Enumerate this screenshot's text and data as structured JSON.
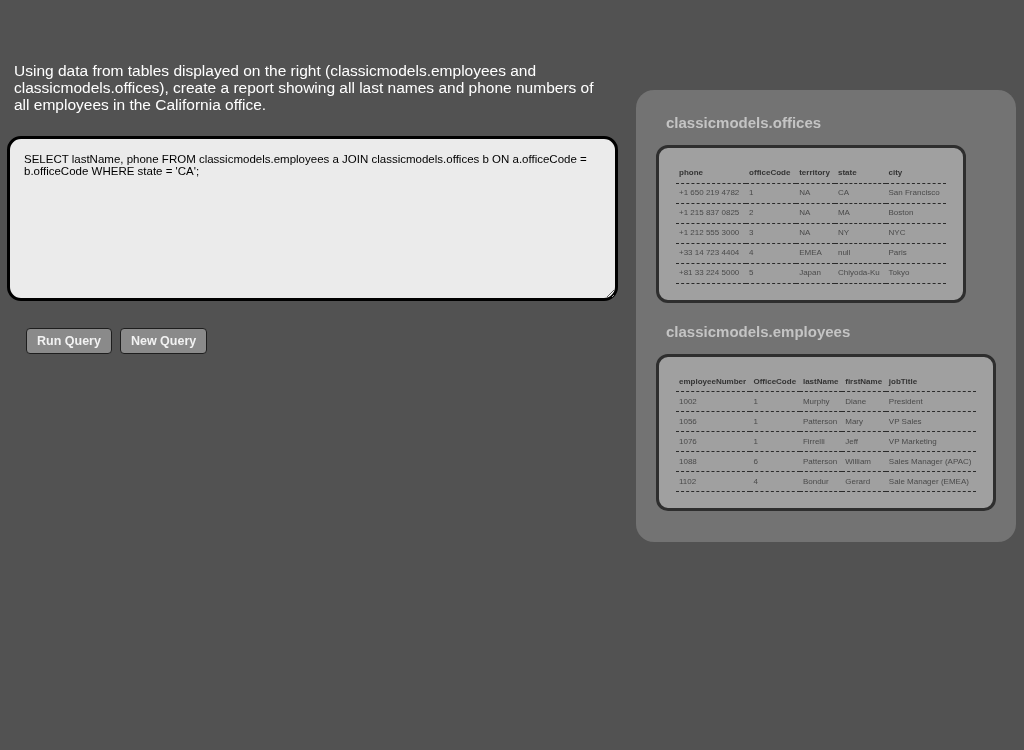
{
  "instructions": "Using data from tables displayed on the right (classicmodels.employees and classicmodels.offices), create a report showing all last names and phone numbers of all employees in the California office.",
  "query_editor": {
    "value": "SELECT lastName, phone FROM classicmodels.employees a JOIN classicmodels.offices b ON a.officeCode = b.officeCode WHERE state = 'CA';"
  },
  "buttons": [
    {
      "label": "Run Query"
    },
    {
      "label": "New Query"
    }
  ],
  "tables": [
    {
      "title": "classicmodels.offices",
      "columns": [
        "phone",
        "officeCode",
        "territory",
        "state",
        "city"
      ],
      "rows": [
        [
          "+1 650 219 4782",
          "1",
          "NA",
          "CA",
          "San Francisco"
        ],
        [
          "+1 215 837 0825",
          "2",
          "NA",
          "MA",
          "Boston"
        ],
        [
          "+1 212 555 3000",
          "3",
          "NA",
          "NY",
          "NYC"
        ],
        [
          "+33 14 723 4404",
          "4",
          "EMEA",
          "null",
          "Paris"
        ],
        [
          "+81 33 224 5000",
          "5",
          "Japan",
          "Chiyoda-Ku",
          "Tokyo"
        ]
      ]
    },
    {
      "title": "classicmodels.employees",
      "columns": [
        "employeeNumber",
        "OfficeCode",
        "lastName",
        "firstName",
        "jobTitle"
      ],
      "rows": [
        [
          "1002",
          "1",
          "Murphy",
          "Diane",
          "President"
        ],
        [
          "1056",
          "1",
          "Patterson",
          "Mary",
          "VP Sales"
        ],
        [
          "1076",
          "1",
          "Firrelli",
          "Jeff",
          "VP Marketing"
        ],
        [
          "1088",
          "6",
          "Patterson",
          "William",
          "Sales Manager (APAC)"
        ],
        [
          "1102",
          "4",
          "Bondur",
          "Gerard",
          "Sale Manager (EMEA)"
        ]
      ]
    }
  ]
}
